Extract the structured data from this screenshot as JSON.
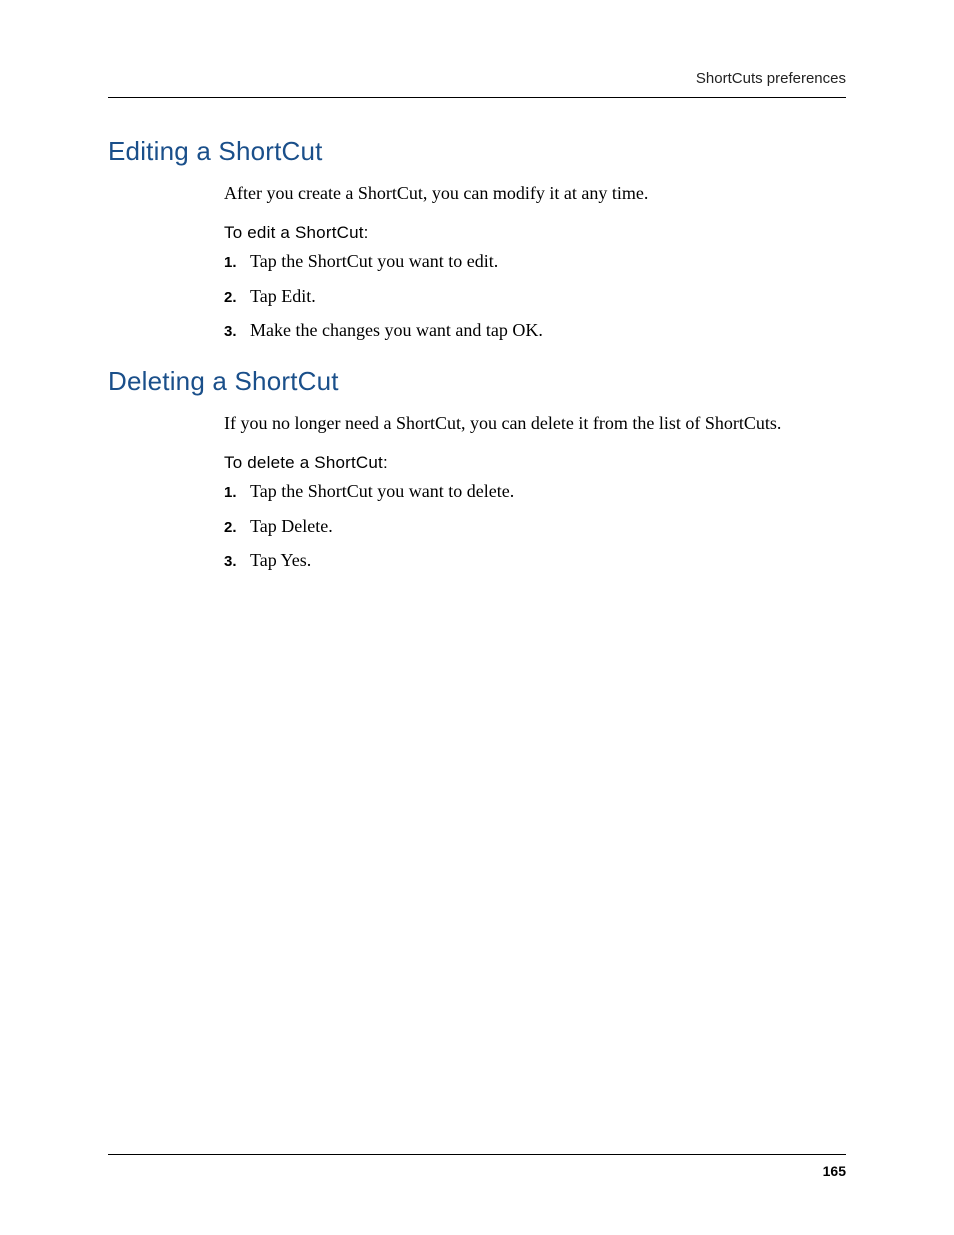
{
  "header": {
    "right_text": "ShortCuts preferences"
  },
  "sections": {
    "editing": {
      "heading": "Editing a ShortCut",
      "intro": "After you create a ShortCut, you can modify it at any time.",
      "subhead": "To edit a ShortCut:",
      "steps": [
        {
          "num": "1.",
          "text": "Tap the ShortCut you want to edit."
        },
        {
          "num": "2.",
          "text": "Tap Edit."
        },
        {
          "num": "3.",
          "text": "Make the changes you want and tap OK."
        }
      ]
    },
    "deleting": {
      "heading": "Deleting a ShortCut",
      "intro": "If you no longer need a ShortCut, you can delete it from the list of ShortCuts.",
      "subhead": "To delete a ShortCut:",
      "steps": [
        {
          "num": "1.",
          "text": "Tap the ShortCut you want to delete."
        },
        {
          "num": "2.",
          "text": "Tap Delete."
        },
        {
          "num": "3.",
          "text": "Tap Yes."
        }
      ]
    }
  },
  "footer": {
    "page_number": "165"
  }
}
